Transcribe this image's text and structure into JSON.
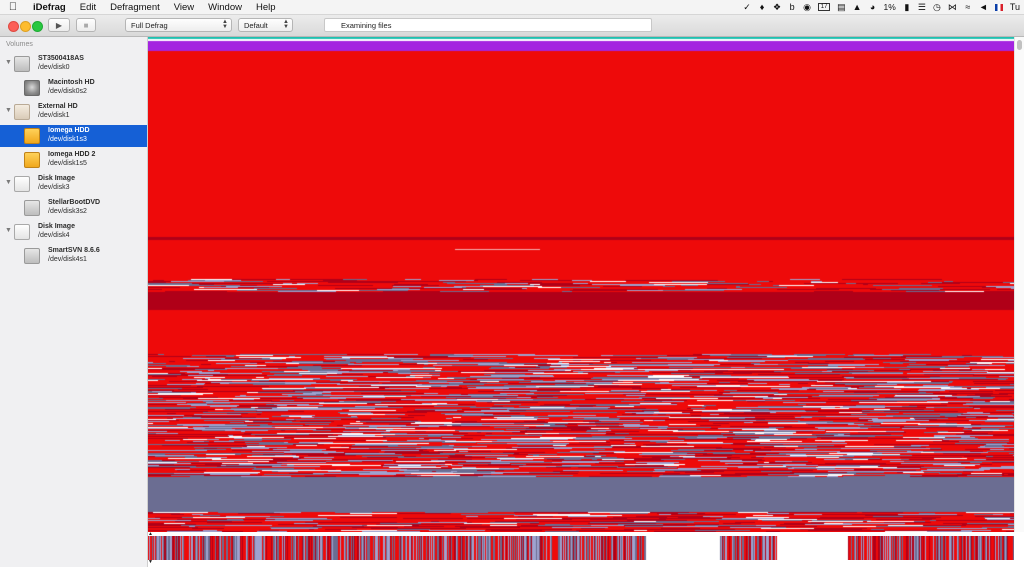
{
  "menubar": {
    "apple_icon": "apple-logo",
    "items": [
      "iDefrag",
      "Edit",
      "Defragment",
      "View",
      "Window",
      "Help"
    ],
    "status_icons": [
      "check-circle-icon",
      "bell-icon",
      "dropbox-icon",
      "b-icon",
      "eye-icon",
      "calendar-icon",
      "document-icon",
      "adobe-icon",
      "pie-icon",
      "battery-icon",
      "sliders-icon",
      "clock-icon",
      "bluetooth-icon",
      "wifi-icon",
      "volume-icon",
      "flag-icon"
    ],
    "cpu_percent": "1%",
    "calendar_day": "17",
    "trailing_text": "Tu"
  },
  "toolbar": {
    "play_icon": "▶",
    "stop_icon": "■",
    "mode_select": "Full Defrag",
    "profile_select": "Default",
    "status_text": "Examining files"
  },
  "sidebar": {
    "header": "Volumes",
    "volumes": [
      {
        "name": "ST3500418AS",
        "dev": "/dev/disk0",
        "level": 0,
        "icon": "internal-disk-icon",
        "expanded": true
      },
      {
        "name": "Macintosh HD",
        "dev": "/dev/disk0s2",
        "level": 1,
        "icon": "macintosh-hd-icon"
      },
      {
        "name": "External HD",
        "dev": "/dev/disk1",
        "level": 0,
        "icon": "external-disk-icon",
        "expanded": true
      },
      {
        "name": "Iomega HDD",
        "dev": "/dev/disk1s3",
        "level": 1,
        "icon": "external-volume-icon",
        "selected": true
      },
      {
        "name": "Iomega HDD 2",
        "dev": "/dev/disk1s5",
        "level": 1,
        "icon": "external-volume-icon"
      },
      {
        "name": "Disk Image",
        "dev": "/dev/disk3",
        "level": 0,
        "icon": "disk-image-icon",
        "expanded": true
      },
      {
        "name": "StellarBootDVD",
        "dev": "/dev/disk3s2",
        "level": 1,
        "icon": "mounted-image-icon"
      },
      {
        "name": "Disk Image",
        "dev": "/dev/disk4",
        "level": 0,
        "icon": "disk-image-icon",
        "expanded": true
      },
      {
        "name": "SmartSVN 8.6.6",
        "dev": "/dev/disk4s1",
        "level": 1,
        "icon": "mounted-image-icon"
      }
    ]
  },
  "disk_map": {
    "colors": {
      "fragmented": "#ee0a0a",
      "fragmented_dark": "#b00018",
      "unfragmented": "#6b6d92",
      "unfragmented_light": "#9ea2cf",
      "metadata": "#a424e0",
      "header_stripe": "#20c0b0",
      "free": "#ffffff"
    }
  },
  "colors": {
    "selection": "#1560d6",
    "sidebar_bg": "#f0f0f2"
  }
}
